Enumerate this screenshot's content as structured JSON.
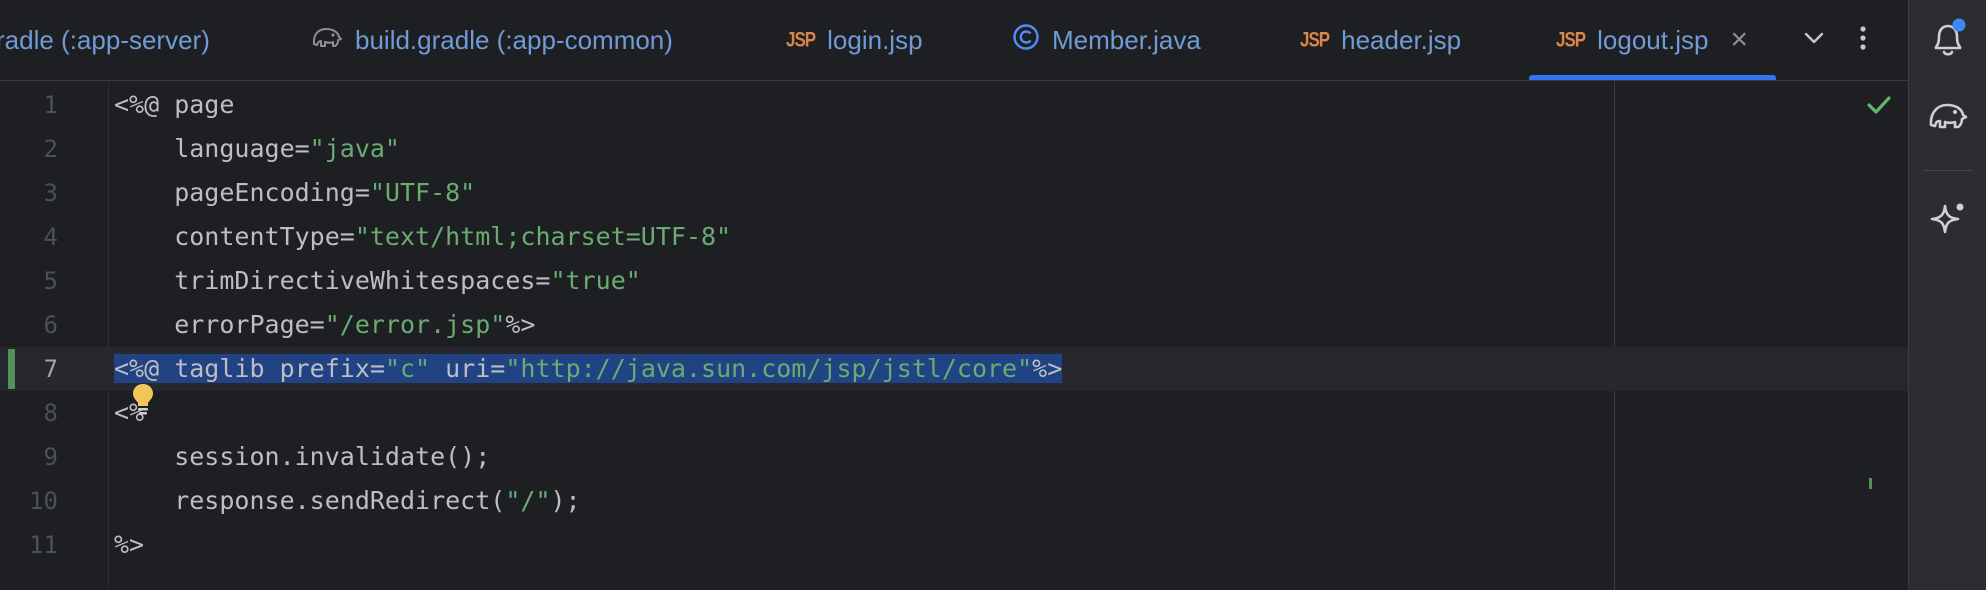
{
  "tabs": [
    {
      "label": "radle (:app-server)",
      "icon": "gradle-elephant-icon",
      "active": false
    },
    {
      "label": "build.gradle (:app-common)",
      "icon": "gradle-elephant-icon",
      "active": false
    },
    {
      "label": "login.jsp",
      "icon": "jsp-icon",
      "icon_text": "JSP",
      "active": false
    },
    {
      "label": "Member.java",
      "icon": "java-class-icon",
      "active": false
    },
    {
      "label": "header.jsp",
      "icon": "jsp-icon",
      "icon_text": "JSP",
      "active": false
    },
    {
      "label": "logout.jsp",
      "icon": "jsp-icon",
      "icon_text": "JSP",
      "active": true
    }
  ],
  "tab_tools": {
    "dropdown": "chevron-down-icon",
    "more": "more-vertical-icon",
    "close": "close-icon"
  },
  "right_strip": [
    {
      "icon": "notifications-bell-icon",
      "badge": true
    },
    {
      "icon": "gradle-elephant-icon"
    },
    {
      "icon": "ai-assistant-sparkle-icon"
    }
  ],
  "editor": {
    "current_line": 7,
    "inspection_status": "ok-check-icon",
    "lines": [
      {
        "n": "1",
        "parts": [
          [
            "t",
            "<%@ page"
          ]
        ]
      },
      {
        "n": "2",
        "parts": [
          [
            "t",
            "    language="
          ],
          [
            "s",
            "\"java\""
          ]
        ]
      },
      {
        "n": "3",
        "parts": [
          [
            "t",
            "    pageEncoding="
          ],
          [
            "s",
            "\"UTF-8\""
          ]
        ]
      },
      {
        "n": "4",
        "parts": [
          [
            "t",
            "    contentType="
          ],
          [
            "s",
            "\"text/html;charset=UTF-8\""
          ]
        ]
      },
      {
        "n": "5",
        "parts": [
          [
            "t",
            "    trimDirectiveWhitespaces="
          ],
          [
            "s",
            "\"true\""
          ]
        ]
      },
      {
        "n": "6",
        "parts": [
          [
            "t",
            "    errorPage="
          ],
          [
            "s",
            "\"/error.jsp\""
          ],
          [
            "t",
            "%>"
          ]
        ]
      },
      {
        "n": "7",
        "parts": [
          [
            "t",
            "<%@ taglib prefix="
          ],
          [
            "s",
            "\"c\""
          ],
          [
            "t",
            " uri="
          ],
          [
            "s",
            "\"http://java.sun.com/jsp/jstl/core\""
          ],
          [
            "t",
            "%>"
          ]
        ],
        "selected": true
      },
      {
        "n": "8",
        "parts": [
          [
            "t",
            "<%"
          ]
        ]
      },
      {
        "n": "9",
        "parts": [
          [
            "t",
            "    session.invalidate();"
          ]
        ]
      },
      {
        "n": "10",
        "parts": [
          [
            "t",
            "    response.sendRedirect("
          ],
          [
            "s",
            "\"/\""
          ],
          [
            "t",
            ");"
          ]
        ]
      },
      {
        "n": "11",
        "parts": [
          [
            "t",
            "%>"
          ]
        ]
      }
    ]
  },
  "colors": {
    "background": "#1e1f22",
    "string": "#6aab73",
    "text": "#bcbec4",
    "selection": "#214283",
    "accent": "#3574f0",
    "jsp_icon": "#d9864b",
    "check": "#5fb865"
  }
}
